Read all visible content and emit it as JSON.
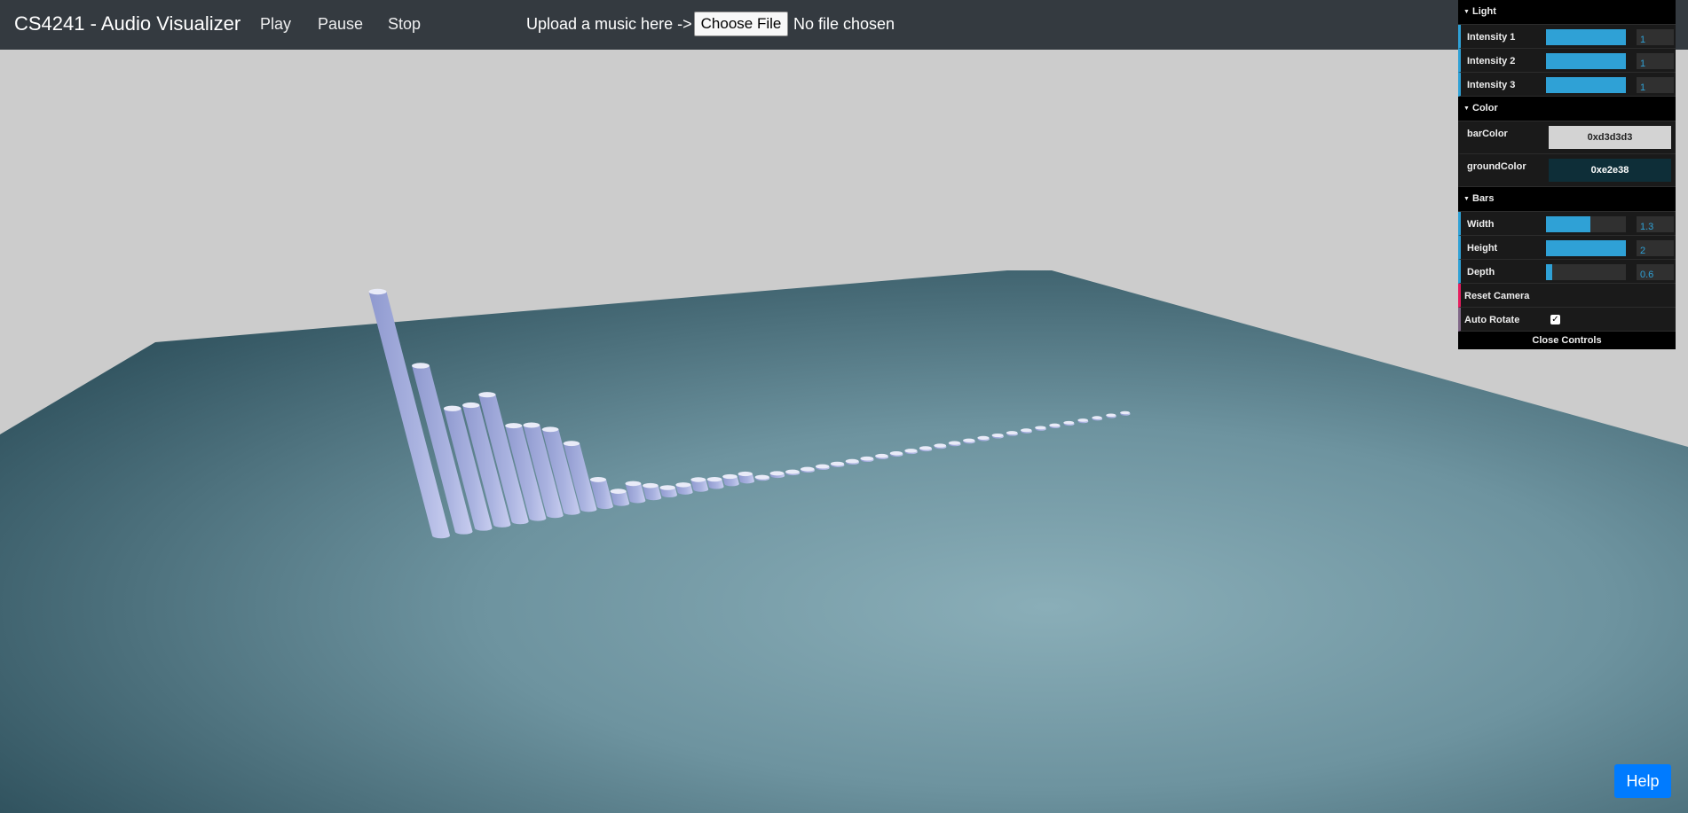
{
  "navbar": {
    "brand": "CS4241 - Audio Visualizer",
    "play_label": "Play",
    "pause_label": "Pause",
    "stop_label": "Stop",
    "upload_label": "Upload a music here ->",
    "file_button_label": "Choose File",
    "file_status": "No file chosen"
  },
  "gui": {
    "light": {
      "title": "Light",
      "rows": [
        {
          "label": "Intensity 1",
          "value": "1",
          "fill_fraction": 1.0
        },
        {
          "label": "Intensity 2",
          "value": "1",
          "fill_fraction": 1.0
        },
        {
          "label": "Intensity 3",
          "value": "1",
          "fill_fraction": 1.0
        }
      ]
    },
    "color": {
      "title": "Color",
      "bar_color_label": "barColor",
      "bar_color_value": "0xd3d3d3",
      "bar_color_hex": "#d3d3d3",
      "ground_color_label": "groundColor",
      "ground_color_value": "0xe2e38",
      "ground_color_hex": "#0e2e38"
    },
    "bars": {
      "title": "Bars",
      "rows": [
        {
          "label": "Width",
          "value": "1.3",
          "fill_fraction": 0.55
        },
        {
          "label": "Height",
          "value": "2",
          "fill_fraction": 1.0
        },
        {
          "label": "Depth",
          "value": "0.6",
          "fill_fraction": 0.08
        }
      ]
    },
    "reset_camera_label": "Reset Camera",
    "auto_rotate_label": "Auto Rotate",
    "auto_rotate_checked": true,
    "close_label": "Close Controls"
  },
  "help_label": "Help",
  "colors": {
    "navbar": "#343a40",
    "accent": "#2fa1d6",
    "help": "#007bff",
    "sky": "#cccccc"
  },
  "visualizer": {
    "bar_levels": [
      1.0,
      0.68,
      0.49,
      0.49,
      0.52,
      0.38,
      0.37,
      0.34,
      0.27,
      0.11,
      0.05,
      0.07,
      0.05,
      0.03,
      0.03,
      0.04,
      0.03,
      0.03,
      0.03,
      0.0,
      0.01,
      0.0,
      0.0,
      0.0,
      0.0,
      0.0,
      0.0,
      0.0,
      0.0,
      0.0,
      0.0,
      0.0,
      0.0,
      0.0,
      0.0,
      0.0,
      0.0,
      0.0,
      0.0,
      0.0,
      0.0,
      0.0,
      0.0,
      0.0,
      0.0
    ]
  }
}
